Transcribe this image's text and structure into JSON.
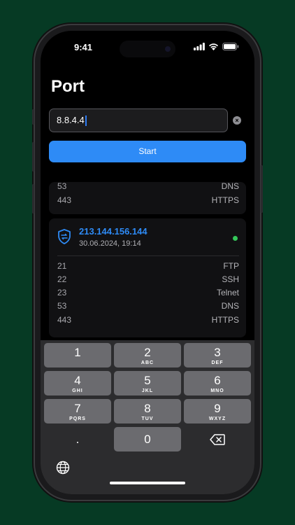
{
  "status_bar": {
    "time": "9:41"
  },
  "page": {
    "title": "Port"
  },
  "ip_field": {
    "value": "8.8.4.4"
  },
  "start_button": {
    "label": "Start"
  },
  "top_card": {
    "rows": [
      {
        "port": "53",
        "service": "DNS"
      },
      {
        "port": "443",
        "service": "HTTPS"
      }
    ]
  },
  "result_card": {
    "ip": "213.144.156.144",
    "datetime": "30.06.2024, 19:14",
    "status_color": "#34c759",
    "rows": [
      {
        "port": "21",
        "service": "FTP"
      },
      {
        "port": "22",
        "service": "SSH"
      },
      {
        "port": "23",
        "service": "Telnet"
      },
      {
        "port": "53",
        "service": "DNS"
      },
      {
        "port": "443",
        "service": "HTTPS"
      }
    ]
  },
  "keypad": {
    "keys": [
      {
        "num": "1",
        "letters": ""
      },
      {
        "num": "2",
        "letters": "ABC"
      },
      {
        "num": "3",
        "letters": "DEF"
      },
      {
        "num": "4",
        "letters": "GHI"
      },
      {
        "num": "5",
        "letters": "JKL"
      },
      {
        "num": "6",
        "letters": "MNO"
      },
      {
        "num": "7",
        "letters": "PQRS"
      },
      {
        "num": "8",
        "letters": "TUV"
      },
      {
        "num": "9",
        "letters": "WXYZ"
      },
      {
        "num": ".",
        "letters": ""
      },
      {
        "num": "0",
        "letters": ""
      }
    ],
    "delete_icon": "backspace-icon",
    "globe_icon": "globe-icon"
  },
  "colors": {
    "accent": "#2e8bf6",
    "background": "#063a24"
  }
}
